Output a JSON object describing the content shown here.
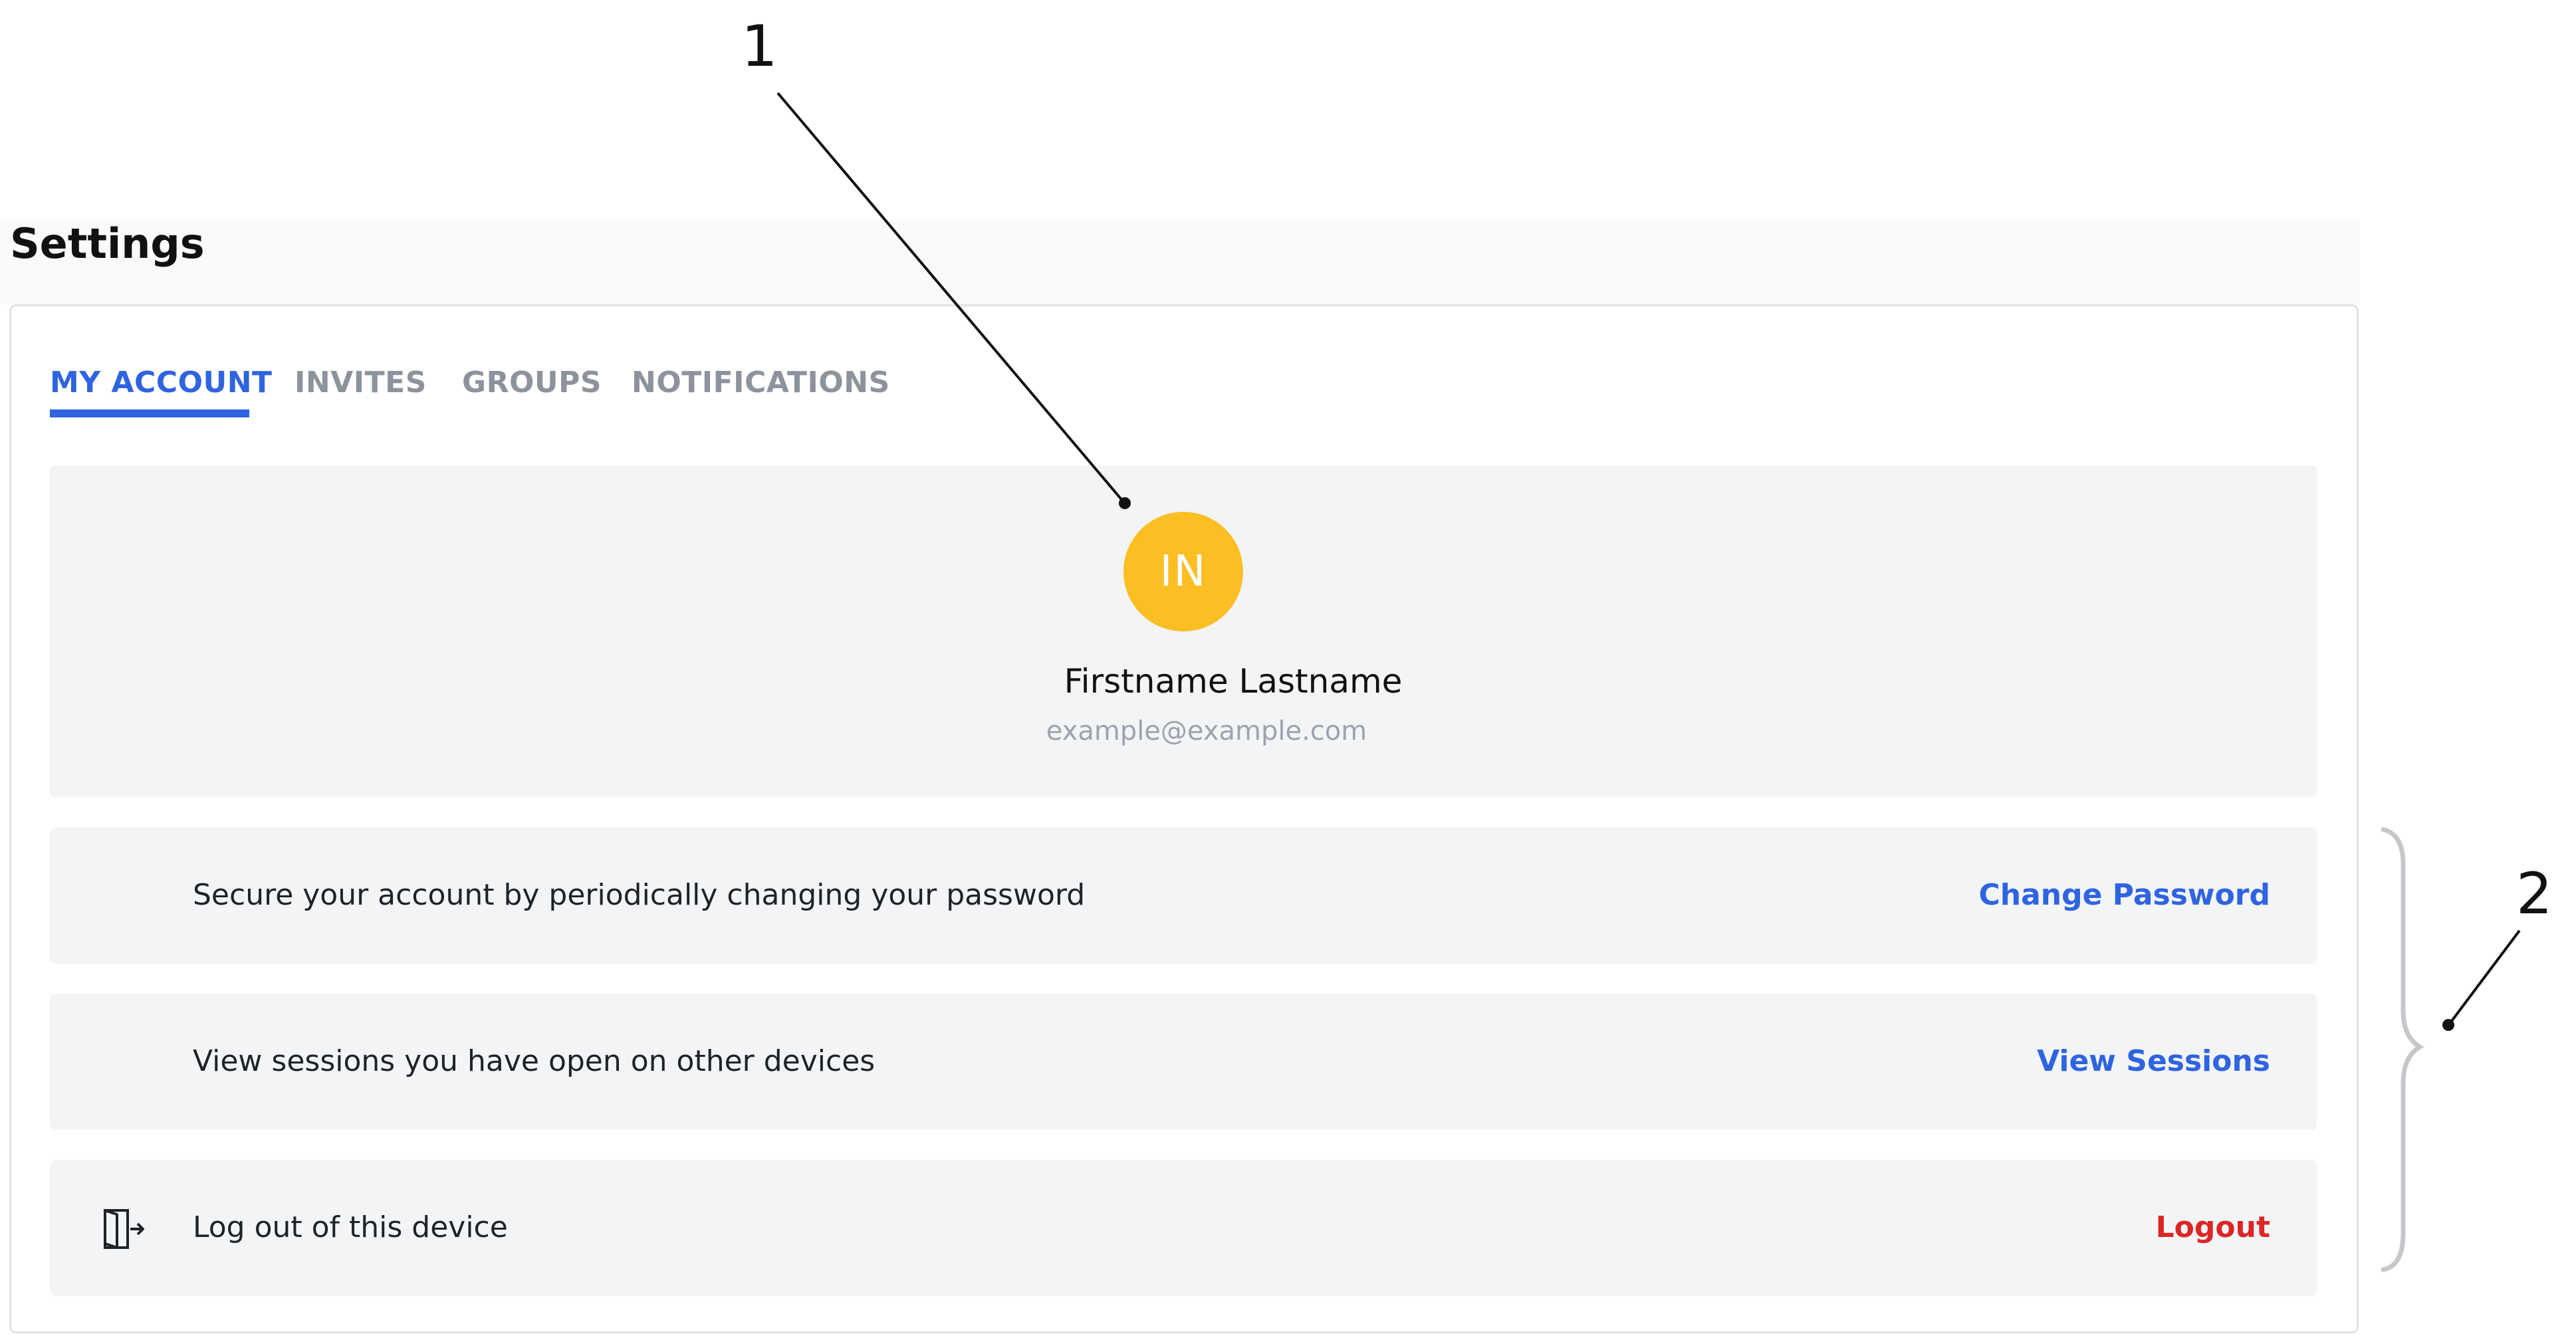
{
  "page": {
    "title": "Settings"
  },
  "tabs": [
    {
      "label": "MY ACCOUNT",
      "active": true
    },
    {
      "label": "INVITES",
      "active": false
    },
    {
      "label": "GROUPS",
      "active": false
    },
    {
      "label": "NOTIFICATIONS",
      "active": false
    }
  ],
  "profile": {
    "initials": "IN",
    "name": "Firstname Lastname",
    "email": "example@example.com",
    "avatar_color": "#fbbf24"
  },
  "rows": [
    {
      "text": "Secure your account by periodically changing your password",
      "action": "Change Password",
      "icon": ""
    },
    {
      "text": "View sessions you have open on other devices",
      "action": "View Sessions",
      "icon": ""
    },
    {
      "text": "Log out of this device",
      "action": "Logout",
      "icon": "logout-door-icon"
    }
  ],
  "annotations": {
    "label_1": "1",
    "label_2": "2"
  },
  "colors": {
    "accent": "#2f64e0",
    "danger": "#dc2626",
    "panel": "#f3f4f6"
  }
}
